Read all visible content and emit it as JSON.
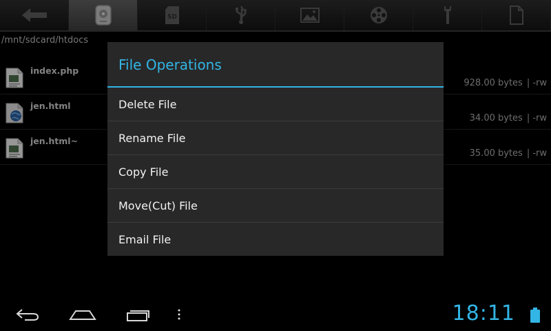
{
  "toolbar": {
    "items": [
      {
        "icon": "back-arrow-icon",
        "active": false
      },
      {
        "icon": "storage-disk-icon",
        "active": true
      },
      {
        "icon": "sd-card-icon",
        "active": false,
        "label": "SD"
      },
      {
        "icon": "usb-icon",
        "active": false
      },
      {
        "icon": "image-icon",
        "active": false
      },
      {
        "icon": "film-reel-icon",
        "active": false
      },
      {
        "icon": "wrench-icon",
        "active": false
      },
      {
        "icon": "document-icon",
        "active": false
      }
    ]
  },
  "path": "/mnt/sdcard/htdocs",
  "files": [
    {
      "name": "index.php",
      "size": "928.00 bytes",
      "perm": "| -rw",
      "icon": "text-file-icon"
    },
    {
      "name": "jen.html",
      "size": "34.00 bytes",
      "perm": "| -rw",
      "icon": "html-file-icon"
    },
    {
      "name": "jen.html~",
      "size": "35.00 bytes",
      "perm": "| -rw",
      "icon": "text-file-icon"
    }
  ],
  "dialog": {
    "title": "File Operations",
    "items": [
      {
        "label": "Delete File"
      },
      {
        "label": "Rename File"
      },
      {
        "label": "Copy File"
      },
      {
        "label": "Move(Cut) File"
      },
      {
        "label": "Email File"
      }
    ]
  },
  "status": {
    "time": "18:11"
  },
  "colors": {
    "accent": "#33b5e5",
    "dialog_bg": "#282828",
    "background": "#000000"
  }
}
